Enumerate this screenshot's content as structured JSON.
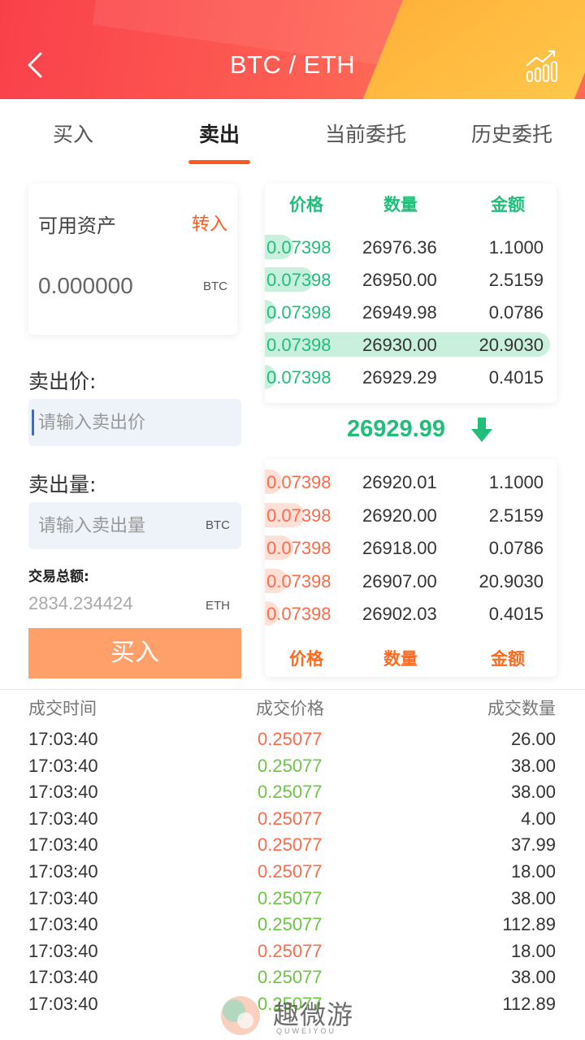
{
  "header": {
    "title": "BTC / ETH",
    "back_icon": "chevron-left-icon",
    "chart_icon": "chart-icon"
  },
  "tabs": [
    {
      "label": "买入",
      "active": false
    },
    {
      "label": "卖出",
      "active": true
    },
    {
      "label": "当前委托",
      "active": false
    },
    {
      "label": "历史委托",
      "active": false
    }
  ],
  "asset": {
    "label": "可用资产",
    "transfer_label": "转入",
    "value": "0.000000",
    "unit": "BTC"
  },
  "sell_price": {
    "label": "卖出价:",
    "placeholder": "请输入卖出价"
  },
  "sell_amount": {
    "label": "卖出量:",
    "placeholder": "请输入卖出量",
    "unit": "BTC"
  },
  "total": {
    "label": "交易总额:",
    "value": "2834.234424",
    "unit": "ETH"
  },
  "submit_label": "买入",
  "orderbook": {
    "headers": [
      "价格",
      "数量",
      "金额"
    ],
    "asks": [
      {
        "price": "0.07398",
        "qty": "26976.36",
        "amount": "1.1000",
        "depth": 0.1
      },
      {
        "price": "0.07398",
        "qty": "26950.00",
        "amount": "2.5159",
        "depth": 0.17
      },
      {
        "price": "0.07398",
        "qty": "26949.98",
        "amount": "0.0786",
        "depth": 0.04
      },
      {
        "price": "0.07398",
        "qty": "26930.00",
        "amount": "20.9030",
        "depth": 1.0
      },
      {
        "price": "0.07398",
        "qty": "26929.29",
        "amount": "0.4015",
        "depth": 0.04
      }
    ],
    "last_price": "26929.99",
    "bids": [
      {
        "price": "0.07398",
        "qty": "26920.01",
        "amount": "1.1000",
        "depth": 0.06
      },
      {
        "price": "0.07398",
        "qty": "26920.00",
        "amount": "2.5159",
        "depth": 0.14
      },
      {
        "price": "0.07398",
        "qty": "26918.00",
        "amount": "0.0786",
        "depth": 0.1
      },
      {
        "price": "0.07398",
        "qty": "26907.00",
        "amount": "20.9030",
        "depth": 0.08
      },
      {
        "price": "0.07398",
        "qty": "26902.03",
        "amount": "0.4015",
        "depth": 0.05
      }
    ],
    "colors": {
      "ask": "#1fbf7a",
      "bid": "#ff6a4a"
    }
  },
  "trades": {
    "headers": [
      "成交时间",
      "成交价格",
      "成交数量"
    ],
    "rows": [
      {
        "time": "17:03:40",
        "price": "0.25077",
        "qty": "26.00",
        "side": "red"
      },
      {
        "time": "17:03:40",
        "price": "0.25077",
        "qty": "38.00",
        "side": "green"
      },
      {
        "time": "17:03:40",
        "price": "0.25077",
        "qty": "38.00",
        "side": "green"
      },
      {
        "time": "17:03:40",
        "price": "0.25077",
        "qty": "4.00",
        "side": "red"
      },
      {
        "time": "17:03:40",
        "price": "0.25077",
        "qty": "37.99",
        "side": "red"
      },
      {
        "time": "17:03:40",
        "price": "0.25077",
        "qty": "18.00",
        "side": "red"
      },
      {
        "time": "17:03:40",
        "price": "0.25077",
        "qty": "38.00",
        "side": "green"
      },
      {
        "time": "17:03:40",
        "price": "0.25077",
        "qty": "112.89",
        "side": "green"
      },
      {
        "time": "17:03:40",
        "price": "0.25077",
        "qty": "18.00",
        "side": "red"
      },
      {
        "time": "17:03:40",
        "price": "0.25077",
        "qty": "38.00",
        "side": "green"
      },
      {
        "time": "17:03:40",
        "price": "0.25077",
        "qty": "112.89",
        "side": "green"
      }
    ]
  },
  "watermark": {
    "text": "趣微游",
    "sub": "QUWEIYOU"
  }
}
